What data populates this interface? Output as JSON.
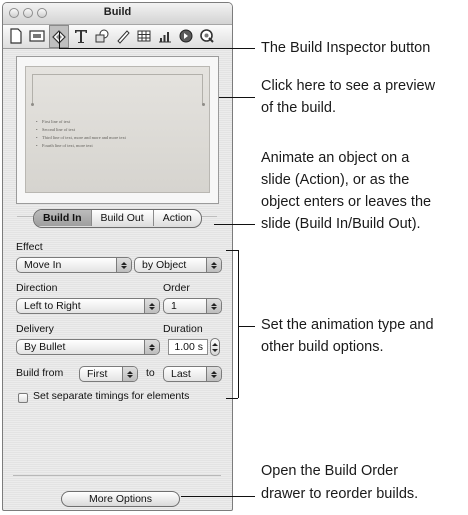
{
  "window": {
    "title": "Build"
  },
  "toolbar": {
    "icons": [
      "document-icon",
      "slide-icon",
      "build-icon",
      "text-icon",
      "graphic-icon",
      "metrics-icon",
      "table-icon",
      "chart-icon",
      "hyperlink-icon",
      "quicktime-icon"
    ]
  },
  "preview": {
    "bullets": [
      "First line of text",
      "Second line of text",
      "Third line of text, more and more and more text",
      "Fourth line of text, more text"
    ]
  },
  "tabs": {
    "build_in": "Build In",
    "build_out": "Build Out",
    "action": "Action",
    "active": "Build In"
  },
  "effect": {
    "label": "Effect",
    "value": "Move In",
    "scope_value": "by Object"
  },
  "direction": {
    "label": "Direction",
    "value": "Left to Right"
  },
  "order": {
    "label": "Order",
    "value": "1"
  },
  "delivery": {
    "label": "Delivery",
    "value": "By Bullet"
  },
  "duration": {
    "label": "Duration",
    "value": "1.00 s"
  },
  "build_from": {
    "label": "Build from",
    "from_value": "First",
    "to_label": "to",
    "to_value": "Last"
  },
  "separate_timings": {
    "label": "Set separate timings for elements",
    "checked": false
  },
  "more_options": {
    "label": "More Options"
  },
  "callouts": {
    "inspector_button": "The Build Inspector button",
    "preview": [
      "Click here to see a preview",
      "of the build."
    ],
    "animate": [
      "Animate an object on a",
      "slide (Action), or as the",
      "object enters or leaves the",
      "slide (Build In/Build Out)."
    ],
    "animation_type": [
      "Set the animation type and",
      "other build options."
    ],
    "build_order": [
      "Open the Build Order",
      "drawer to reorder builds."
    ]
  }
}
